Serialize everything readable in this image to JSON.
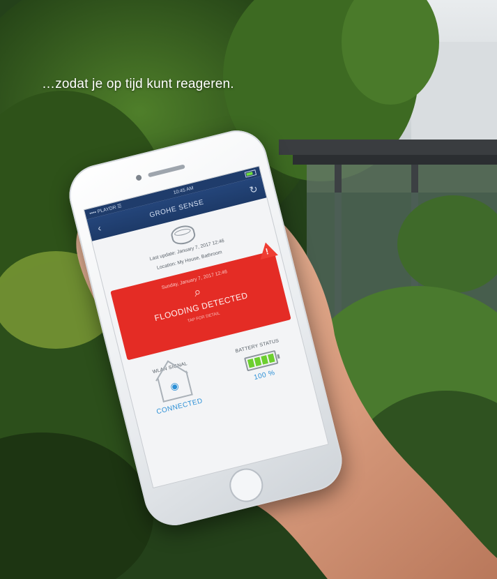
{
  "caption": "…zodat je op tijd kunt reageren.",
  "phone": {
    "status_bar": {
      "carrier": "•••• PLAYDR ☰",
      "time": "10:45 AM"
    },
    "nav": {
      "title": "GROHE SENSE",
      "back_icon": "chevron-left-icon",
      "refresh_icon": "refresh-icon"
    },
    "sensor": {
      "icon": "sensor-device-icon",
      "last_update": "Last update: January 7, 2017 12:46",
      "location": "Location: My House, Bathroom"
    },
    "alert": {
      "date": "Sunday, January 7, 2017 12:46",
      "title": "FLOODING DETECTED",
      "subtitle": "TAP FOR DETAIL",
      "icon": "magnifier-water-icon",
      "warning_icon": "warning-triangle-icon",
      "color": "#e42c25"
    },
    "wlan": {
      "label": "WLAN SIGNAL",
      "value": "CONNECTED",
      "icon": "house-wifi-icon"
    },
    "battery": {
      "label": "BATTERY STATUS",
      "value": "100 %",
      "level_fraction": 1.0,
      "icon": "battery-icon"
    }
  }
}
